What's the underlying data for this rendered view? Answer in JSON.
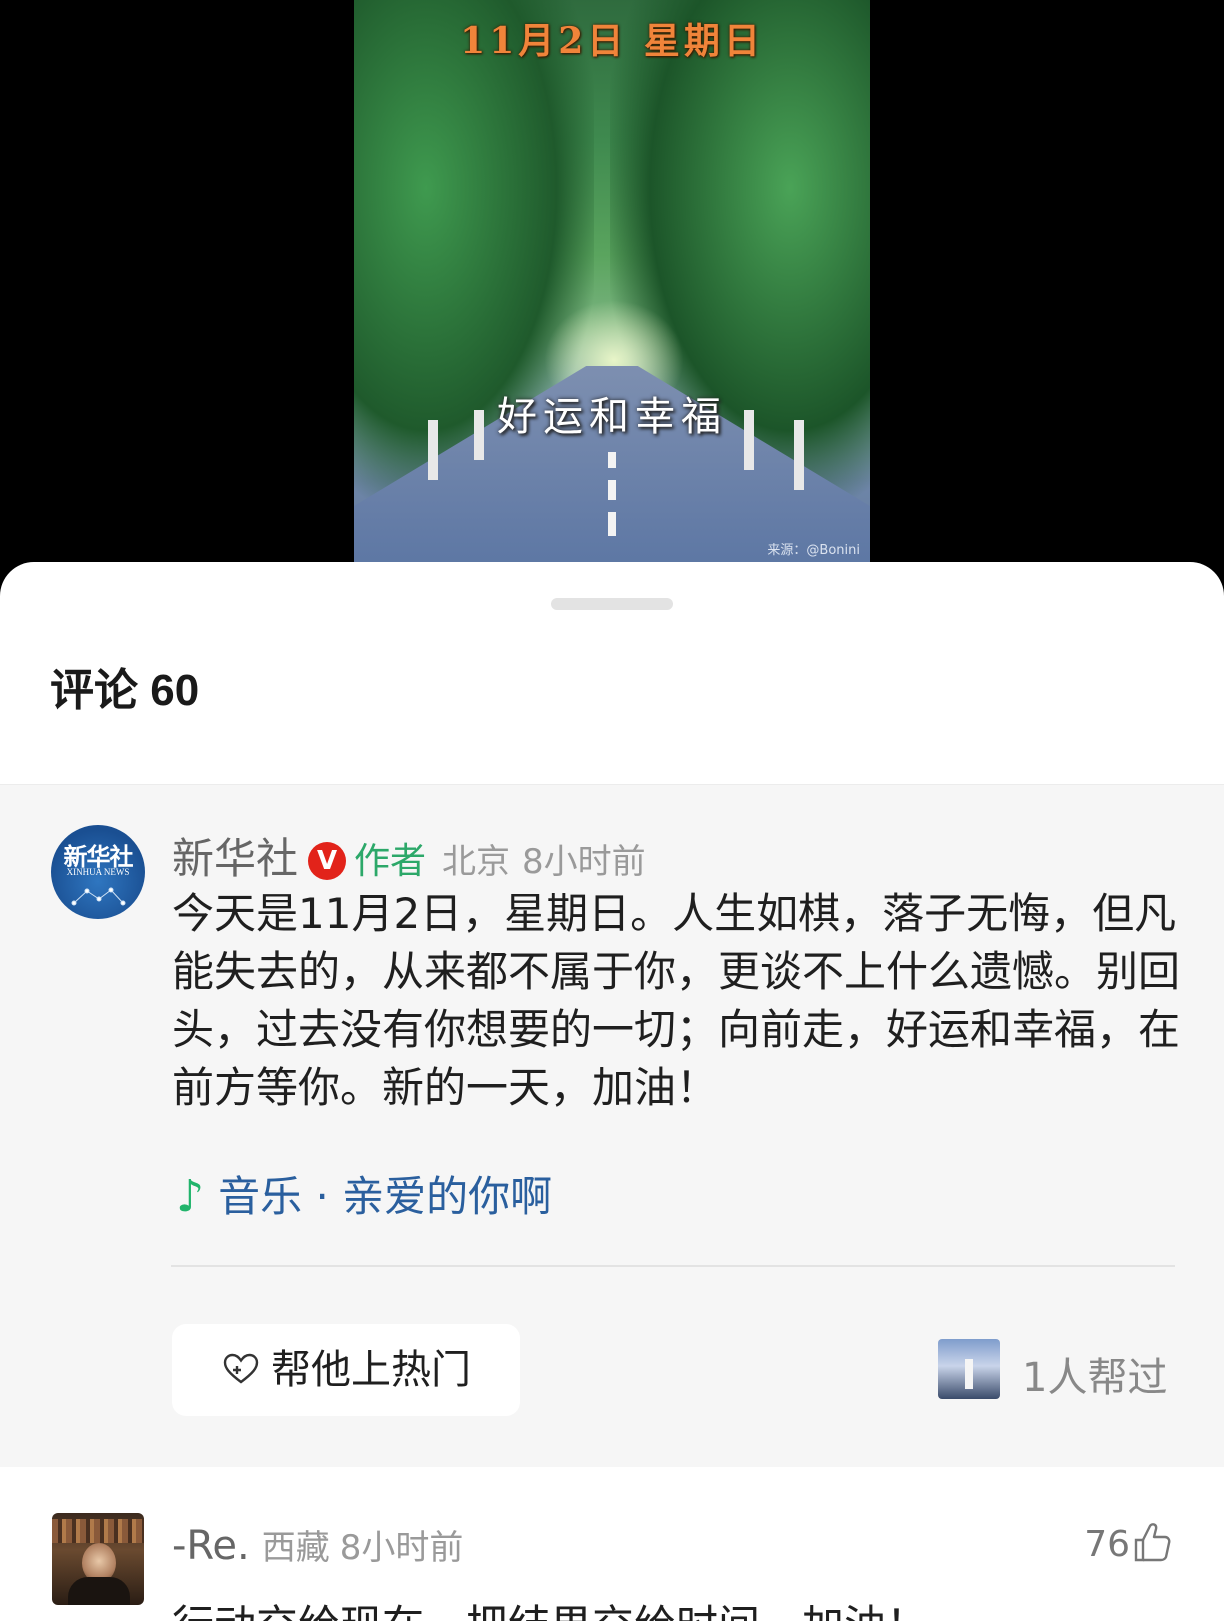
{
  "video": {
    "date_text": "11月2日  星期日",
    "caption": "好运和幸福",
    "source": "来源：@Bonini"
  },
  "comments_header": {
    "label": "评论 60"
  },
  "pinned_comment": {
    "avatar_text": "新华社",
    "avatar_subtext": "XINHUA NEWS",
    "author": "新华社",
    "verified_mark": "V",
    "author_tag": "作者",
    "location": "北京",
    "time": "8小时前",
    "text": "今天是11月2日，星期日。人生如棋，落子无悔，但凡能失去的，从来都不属于你，更谈不上什么遗憾。别回头，过去没有你想要的一切；向前走，好运和幸福，在前方等你。新的一天，加油！",
    "music_icon": "music-note-icon",
    "music_link": "音乐 · 亲爱的你啊",
    "hot_button_icon": "heart-plus-icon",
    "hot_button": "帮他上热门",
    "helpers": "1人帮过"
  },
  "comment2": {
    "author": "-Re.",
    "location": "西藏",
    "time": "8小时前",
    "likes": "76",
    "like_icon": "thumbs-up-icon",
    "text": "行动交给现在，把结果交给时间，加油！"
  },
  "colors": {
    "accent_green": "#2ca869",
    "link_blue": "#2a5f9e",
    "verified_red": "#e2231a",
    "date_orange": "#f0843a"
  }
}
